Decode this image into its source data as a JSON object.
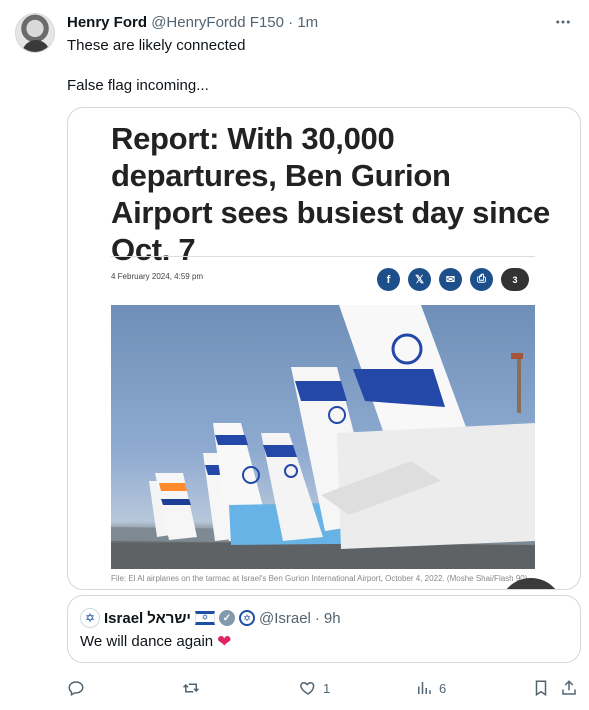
{
  "post": {
    "author_name": "Henry Ford",
    "author_handle": "@HenryFordd F150",
    "separator": "·",
    "time": "1m",
    "text_line1": "These are likely connected",
    "text_line2": "False flag incoming..."
  },
  "media": {
    "headline": "Report: With 30,000 departures, Ben Gurion Airport sees busiest day since Oct. 7",
    "date": "4 February 2024, 4:59 pm",
    "comment_count": "3",
    "caption": "File: El Al airplanes on the tarmac at Israel's Ben Gurion International Airport, October 4, 2022. (Moshe Shai/Flash 90)"
  },
  "quote": {
    "name_en": "Israel",
    "name_he": "ישראל",
    "handle": "@Israel",
    "separator": "·",
    "time": "9h",
    "text": "We will dance again"
  },
  "actions": {
    "reply_count": "",
    "repost_count": "",
    "like_count": "1",
    "views_count": "6"
  },
  "icons": [
    "more-icon",
    "facebook-icon",
    "x-icon",
    "email-icon",
    "print-icon",
    "comments-icon",
    "verified-icon",
    "government-icon",
    "israel-flag-icon",
    "heart-emoji",
    "reply-icon",
    "repost-icon",
    "like-icon",
    "views-icon",
    "bookmark-icon",
    "share-icon"
  ],
  "colors": {
    "accent": "#1d4fa3",
    "muted": "#536471",
    "heart": "#e0245e"
  }
}
